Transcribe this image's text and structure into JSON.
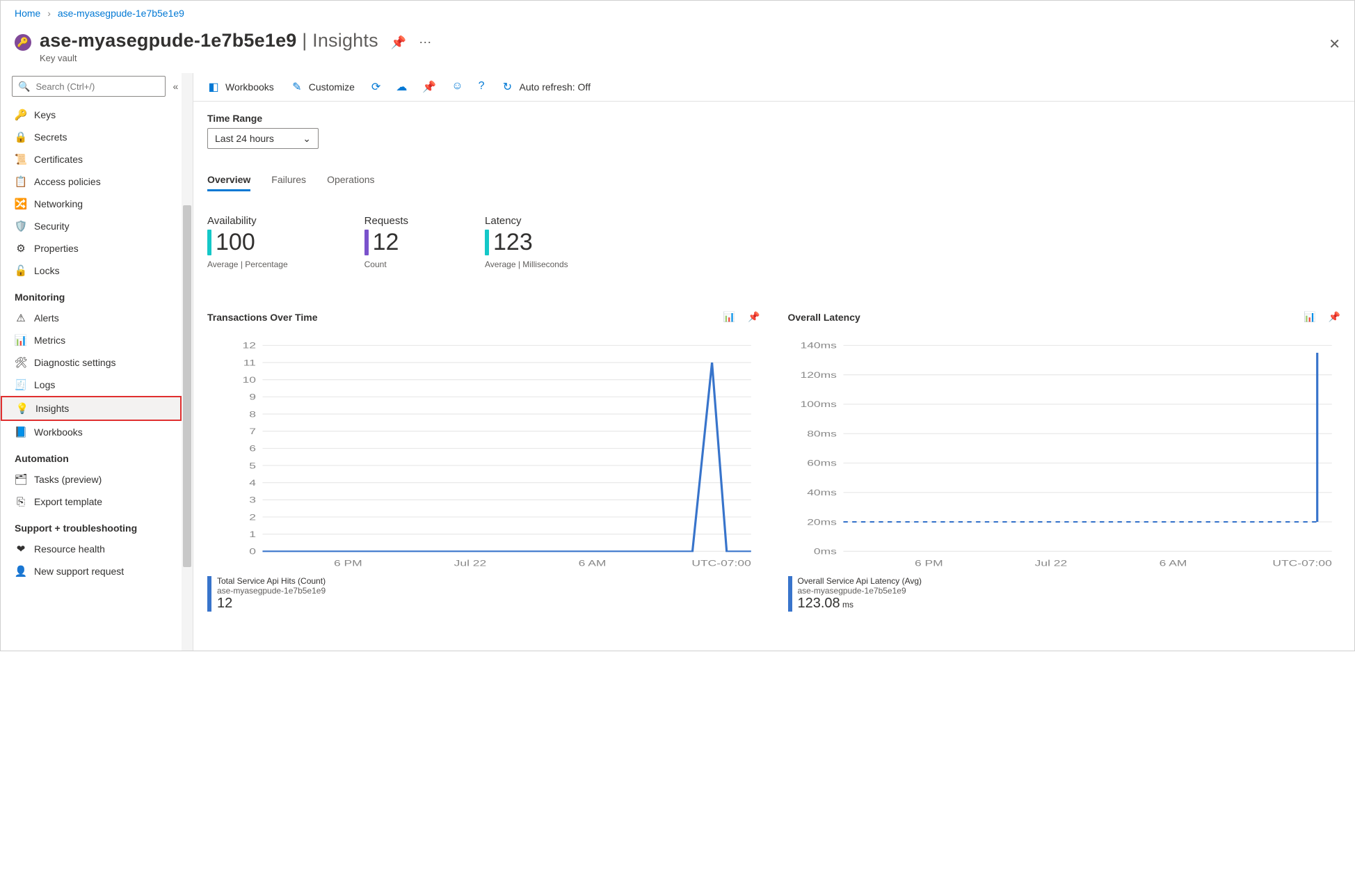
{
  "breadcrumb": {
    "home": "Home",
    "resource": "ase-myasegpude-1e7b5e1e9"
  },
  "header": {
    "title": "ase-myasegpude-1e7b5e1e9",
    "section": "Insights",
    "subtitle": "Key vault",
    "pin_tooltip": "Pin",
    "more": "..."
  },
  "sidebar": {
    "search_placeholder": "Search (Ctrl+/)",
    "items": [
      {
        "label": "Keys",
        "icon": "🔑"
      },
      {
        "label": "Secrets",
        "icon": "🔒"
      },
      {
        "label": "Certificates",
        "icon": "📜"
      },
      {
        "label": "Access policies",
        "icon": "📋"
      },
      {
        "label": "Networking",
        "icon": "🔀"
      },
      {
        "label": "Security",
        "icon": "🛡️"
      },
      {
        "label": "Properties",
        "icon": "⚙"
      },
      {
        "label": "Locks",
        "icon": "🔓"
      }
    ],
    "monitoring_title": "Monitoring",
    "monitoring": [
      {
        "label": "Alerts",
        "icon": "⚠"
      },
      {
        "label": "Metrics",
        "icon": "📊"
      },
      {
        "label": "Diagnostic settings",
        "icon": "🛠"
      },
      {
        "label": "Logs",
        "icon": "🧾"
      },
      {
        "label": "Insights",
        "icon": "💡",
        "highlight": true
      },
      {
        "label": "Workbooks",
        "icon": "📘"
      }
    ],
    "automation_title": "Automation",
    "automation": [
      {
        "label": "Tasks (preview)",
        "icon": "🗂"
      },
      {
        "label": "Export template",
        "icon": "⎘"
      }
    ],
    "support_title": "Support + troubleshooting",
    "support": [
      {
        "label": "Resource health",
        "icon": "❤"
      },
      {
        "label": "New support request",
        "icon": "👤"
      }
    ]
  },
  "toolbar": {
    "workbooks": "Workbooks",
    "customize": "Customize",
    "auto_refresh": "Auto refresh: Off"
  },
  "time_range": {
    "label": "Time Range",
    "value": "Last 24 hours"
  },
  "tabs": {
    "overview": "Overview",
    "failures": "Failures",
    "operations": "Operations"
  },
  "kpis": {
    "availability": {
      "title": "Availability",
      "value": "100",
      "sub": "Average | Percentage",
      "color": "#14c8c8"
    },
    "requests": {
      "title": "Requests",
      "value": "12",
      "sub": "Count",
      "color": "#7a52cc"
    },
    "latency": {
      "title": "Latency",
      "value": "123",
      "sub": "Average | Milliseconds",
      "color": "#14c8c8"
    }
  },
  "chart_data": [
    {
      "id": "transactions",
      "title": "Transactions Over Time",
      "type": "line",
      "x": [
        "6 PM",
        "Jul 22",
        "6 AM"
      ],
      "y_ticks": [
        0,
        1,
        2,
        3,
        4,
        5,
        6,
        7,
        8,
        9,
        10,
        11,
        12
      ],
      "tz_label": "UTC-07:00",
      "series": [
        {
          "name": "Total Service Api Hits (Count)",
          "resource": "ase-myasegpude-1e7b5e1e9",
          "value_display": "12",
          "unit": "",
          "points": [
            [
              0,
              0
            ],
            [
              0.88,
              0
            ],
            [
              0.92,
              11
            ],
            [
              0.95,
              0
            ],
            [
              1.0,
              0
            ]
          ]
        }
      ]
    },
    {
      "id": "latency",
      "title": "Overall Latency",
      "type": "line",
      "x": [
        "6 PM",
        "Jul 22",
        "6 AM"
      ],
      "y_ticks": [
        "0ms",
        "20ms",
        "40ms",
        "60ms",
        "80ms",
        "100ms",
        "120ms",
        "140ms"
      ],
      "tz_label": "UTC-07:00",
      "series": [
        {
          "name": "Overall Service Api Latency (Avg)",
          "resource": "ase-myasegpude-1e7b5e1e9",
          "value_display": "123.08",
          "unit": "ms",
          "baseline": 20,
          "spike_x": 0.97,
          "spike_y": 135
        }
      ]
    }
  ]
}
